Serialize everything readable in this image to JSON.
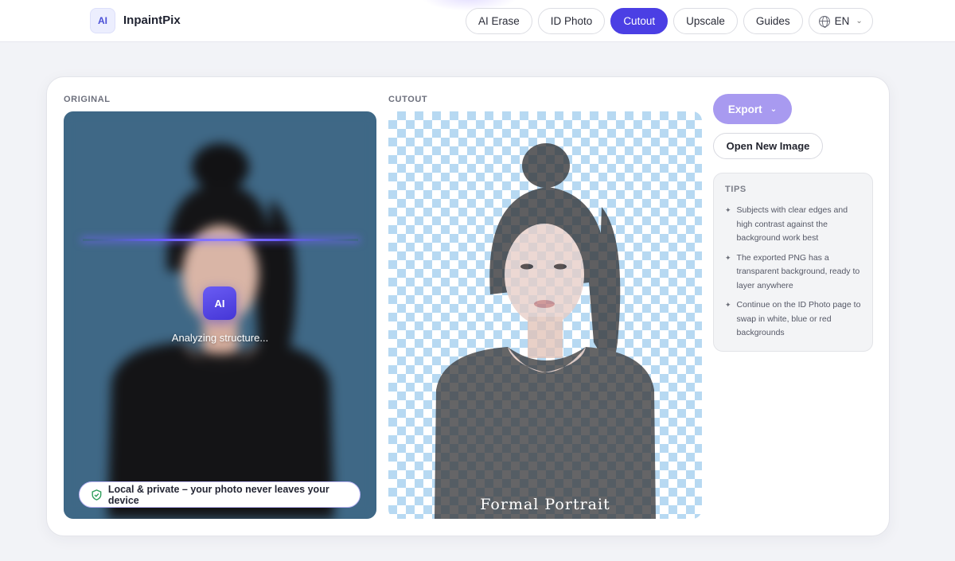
{
  "header": {
    "logo_text": "AI",
    "brand": "InpaintPix",
    "nav": [
      {
        "label": "AI Erase",
        "active": false
      },
      {
        "label": "ID Photo",
        "active": false
      },
      {
        "label": "Cutout",
        "active": true
      },
      {
        "label": "Upscale",
        "active": false
      },
      {
        "label": "Guides",
        "active": false
      }
    ],
    "language": "EN"
  },
  "editor": {
    "original_label": "ORIGINAL",
    "cutout_label": "CUTOUT",
    "ai_chip": "AI",
    "status": "Analyzing structure...",
    "privacy_note": "Local & private – your photo never leaves your device",
    "caption": "Formal Portrait"
  },
  "actions": {
    "export_label": "Export",
    "open_label": "Open New Image"
  },
  "tips": {
    "title": "TIPS",
    "items": [
      "Subjects with clear edges and high contrast against the background work best",
      "The exported PNG has a transparent background, ready to layer anywhere",
      "Continue on the ID Photo page to swap in white, blue or red backgrounds"
    ]
  },
  "colors": {
    "accent": "#4b3fe4",
    "export_button": "#a89af0",
    "original_bg": "#3f6886",
    "checker": "#b7d9f2"
  }
}
